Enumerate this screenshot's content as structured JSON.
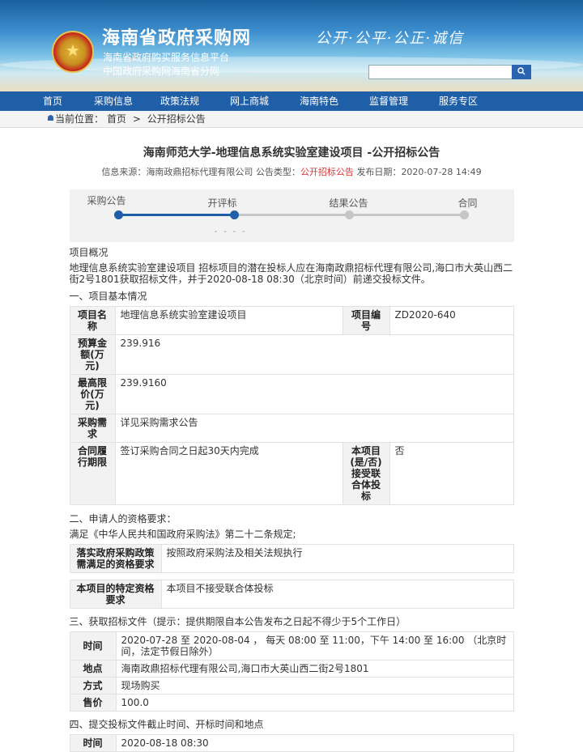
{
  "header": {
    "emblem_symbol": "★",
    "title": "海南省政府采购网",
    "subtitle1": "海南省政府购买服务信息平台",
    "subtitle2": "中国政府采购网海南省分网",
    "slogan": "公开·公平·公正·诚信",
    "search_placeholder": "",
    "search_icon": "search-icon"
  },
  "nav": [
    "首页",
    "采购信息",
    "政策法规",
    "网上商城",
    "海南特色",
    "监督管理",
    "服务专区"
  ],
  "breadcrumb": {
    "icon": "home-icon",
    "current_label": "当前位置：",
    "home": "首页",
    "separator": ">",
    "page": "公开招标公告"
  },
  "notice": {
    "title": "海南师范大学-地理信息系统实验室建设项目 -公开招标公告",
    "source_label": "信息来源：",
    "source": "海南政鼎招标代理有限公司",
    "type_label": "公告类型：",
    "type": "公开招标公告",
    "date_label": "发布日期：",
    "date": "2020-07-28 14:49"
  },
  "progress": {
    "steps": [
      "采购公告",
      "开评标",
      "结果公告",
      "合同"
    ],
    "active_steps": 2,
    "dash": "- - - -",
    "active_color": "#1f5fa8",
    "inactive_color": "#c6c6c6"
  },
  "content": {
    "overview_title": "项目概况",
    "overview_text": "地理信息系统实验室建设项目 招标项目的潜在投标人应在海南政鼎招标代理有限公司,海口市大英山西二街2号1801获取招标文件，并于2020-08-18 08:30（北京时间）前递交投标文件。",
    "s1_title": "一、项目基本情况",
    "basic": {
      "name_label": "项目名称",
      "name": "地理信息系统实验室建设项目",
      "code_label": "项目编号",
      "code": "ZD2020-640",
      "budget_label": "预算金额(万元)",
      "budget": "239.916",
      "max_label": "最高限价(万元)",
      "max": "239.9160",
      "demand_label": "采购需求",
      "demand": "详见采购需求公告",
      "period_label": "合同履行期限",
      "period": "签订采购合同之日起30天内完成",
      "joint_label": "本项目(是/否)接受联合体投标",
      "joint": "否"
    },
    "s2_title": "二、申请人的资格要求：",
    "s2_text": "满足《中华人民共和国政府采购法》第二十二条规定;",
    "policy_label": "落实政府采购政策需满足的资格要求",
    "policy": "按照政府采购法及相关法规执行",
    "special_label": "本项目的特定资格要求",
    "special": "本项目不接受联合体投标",
    "s3_title": "三、获取招标文件（提示：提供期限自本公告发布之日起不得少于5个工作日）",
    "get": {
      "time_label": "时间",
      "time": "2020-07-28 至 2020-08-04 ， 每天 08:00 至 11:00，下午 14:00 至 16:00 （北京时间，法定节假日除外）",
      "place_label": "地点",
      "place": "海南政鼎招标代理有限公司,海口市大英山西二街2号1801",
      "method_label": "方式",
      "method": "现场购买",
      "price_label": "售价",
      "price": "100.0"
    },
    "s4_title": "四、提交投标文件截止时间、开标时间和地点",
    "submit": {
      "time_label": "时间",
      "time": "2020-08-18 08:30"
    }
  }
}
